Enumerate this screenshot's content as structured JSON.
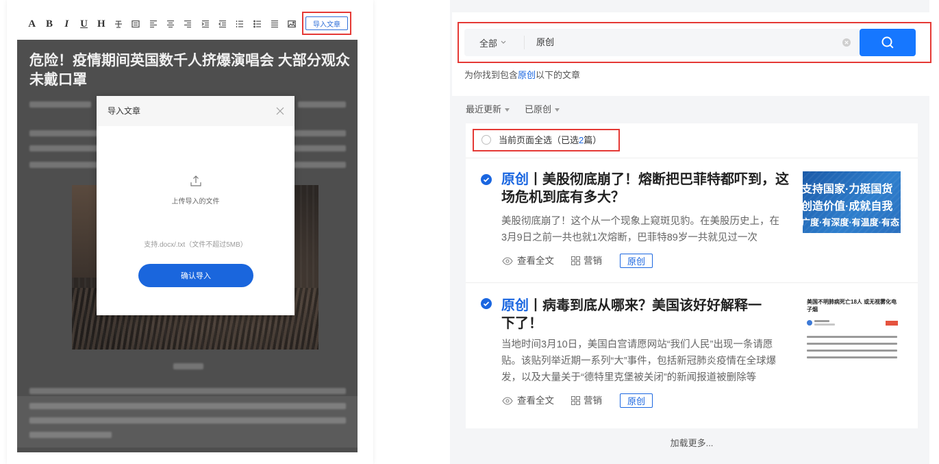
{
  "colors": {
    "accent": "#1a66e0",
    "search_button": "#1677ff",
    "highlight_border": "#e53935",
    "modal_overlay": "#4e4e4e"
  },
  "editor": {
    "toolbar": {
      "letters": [
        "A",
        "B",
        "I",
        "U",
        "H"
      ],
      "icons": [
        "strikethrough-icon",
        "justify-icon",
        "align-left-icon",
        "align-center-icon",
        "align-right-icon",
        "indent-icon",
        "outdent-icon",
        "ordered-list-icon",
        "unordered-list-icon",
        "quote-icon",
        "image-icon"
      ],
      "import_button": "导入文章"
    },
    "article": {
      "title": "危险！疫情期间英国数千人挤爆演唱会 大部分观众未戴口罩"
    }
  },
  "import_modal": {
    "title": "导入文章",
    "close_icon": "close-icon",
    "upload_icon": "upload-icon",
    "upload_label": "上传导入的文件",
    "hint": "支持.docx/.txt（文件不超过5MB）",
    "confirm_button": "确认导入"
  },
  "search": {
    "scope": "全部",
    "query": "原创",
    "search_icon": "search-icon",
    "clear_icon": "clear-icon",
    "summary": {
      "prefix": "为你找到包含",
      "keyword": "原创",
      "suffix": "以下的文章"
    }
  },
  "filters": [
    {
      "label": "最近更新"
    },
    {
      "label": "已原创"
    }
  ],
  "select_all": {
    "prefix": "当前页面全选（已选",
    "count": "2",
    "suffix": "篇）",
    "checked": false
  },
  "results": [
    {
      "selected": true,
      "tag": "原创",
      "separator": "丨",
      "title": "美股彻底崩了！熔断把巴菲特都吓到，这场危机到底有多大？",
      "summary": "美股彻底崩了！这个从一个现象上窥斑见豹。在美股历史上，在3月9日之前一共也就1次熔断，巴菲特89岁一共就见过一次",
      "view_label": "查看全文",
      "marketing_label": "营销",
      "badge": "原创",
      "thumbnail": {
        "lines": [
          "支持国家·力挺国货",
          "创造价值·成就自我",
          "广度·有深度·有温度·有态"
        ]
      }
    },
    {
      "selected": true,
      "tag": "原创",
      "separator": "丨",
      "title": "病毒到底从哪来？美国该好好解释一下了！",
      "summary": "当地时间3月10日，美国白宫请愿网站“我们人民”出现一条请愿贴。该贴列举近期一系列“大”事件，包括新冠肺炎疫情在全球爆发，以及大量关于“德特里克堡被关闭”的新闻报道被删除等",
      "view_label": "查看全文",
      "marketing_label": "营销",
      "badge": "原创",
      "thumbnail": {
        "headline": "美国不明肺病死亡18人 或无视雾化电子烟"
      }
    }
  ],
  "load_more": "加载更多..."
}
